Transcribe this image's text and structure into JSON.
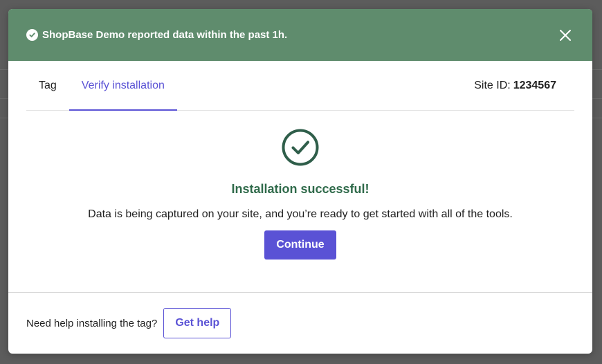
{
  "banner": {
    "message": "ShopBase Demo reported data within the past 1h.",
    "color": "#5f8c6d"
  },
  "tabs": [
    {
      "label": "Tag",
      "active": false
    },
    {
      "label": "Verify installation",
      "active": true
    }
  ],
  "site": {
    "label": "Site ID:",
    "id": "1234567"
  },
  "content": {
    "title": "Installation successful!",
    "description": "Data is being captured on your site, and you’re ready to get started with all of the tools.",
    "continue_label": "Continue"
  },
  "footer": {
    "help_text": "Need help installing the tag?",
    "help_button_label": "Get help"
  },
  "colors": {
    "accent": "#5a52d5",
    "success": "#2f6a4a"
  },
  "icons": {
    "banner": "check-circle-icon",
    "close": "close-icon",
    "success": "check-circle-outline-icon"
  }
}
